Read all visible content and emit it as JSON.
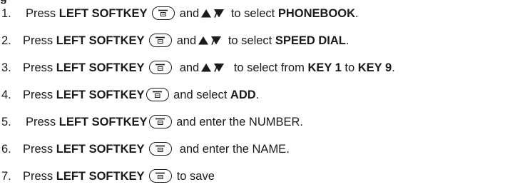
{
  "heading": "g",
  "steps": [
    {
      "number": "1.",
      "t1": "Press ",
      "b1": "LEFT SOFTKEY",
      "t2": " and",
      "t3": " to select ",
      "b2": "PHONEBOOK",
      "t4": "."
    },
    {
      "number": "2.",
      "t1": "Press ",
      "b1": "LEFT SOFTKEY",
      "t2": " and",
      "t3": " to select ",
      "b2": "SPEED DIAL",
      "t4": "."
    },
    {
      "number": "3.",
      "t1": "Press ",
      "b1": "LEFT SOFTKEY",
      "t2": " and",
      "t3": " to select from ",
      "b2": "KEY 1",
      "t4": " to ",
      "b3": "KEY 9",
      "t5": "."
    },
    {
      "number": "4.",
      "t1": "Press ",
      "b1": "LEFT SOFTKEY",
      "t2": " and select ",
      "b2": "ADD",
      "t3": "."
    },
    {
      "number": "5.",
      "t1": "Press ",
      "b1": "LEFT SOFTKEY",
      "t2": " and enter the NUMBER."
    },
    {
      "number": "6.",
      "t1": "Press ",
      "b1": "LEFT SOFTKEY",
      "t2": " and enter the NAME."
    },
    {
      "number": "7.",
      "t1": "Press ",
      "b1": "LEFT SOFTKEY",
      "t2": " to save"
    }
  ],
  "icons": {
    "softkey": "left-softkey-icon",
    "navigation": "up-down-arrows-icon"
  },
  "colors": {
    "text": "#1a1a1a",
    "background": "#ffffff"
  }
}
